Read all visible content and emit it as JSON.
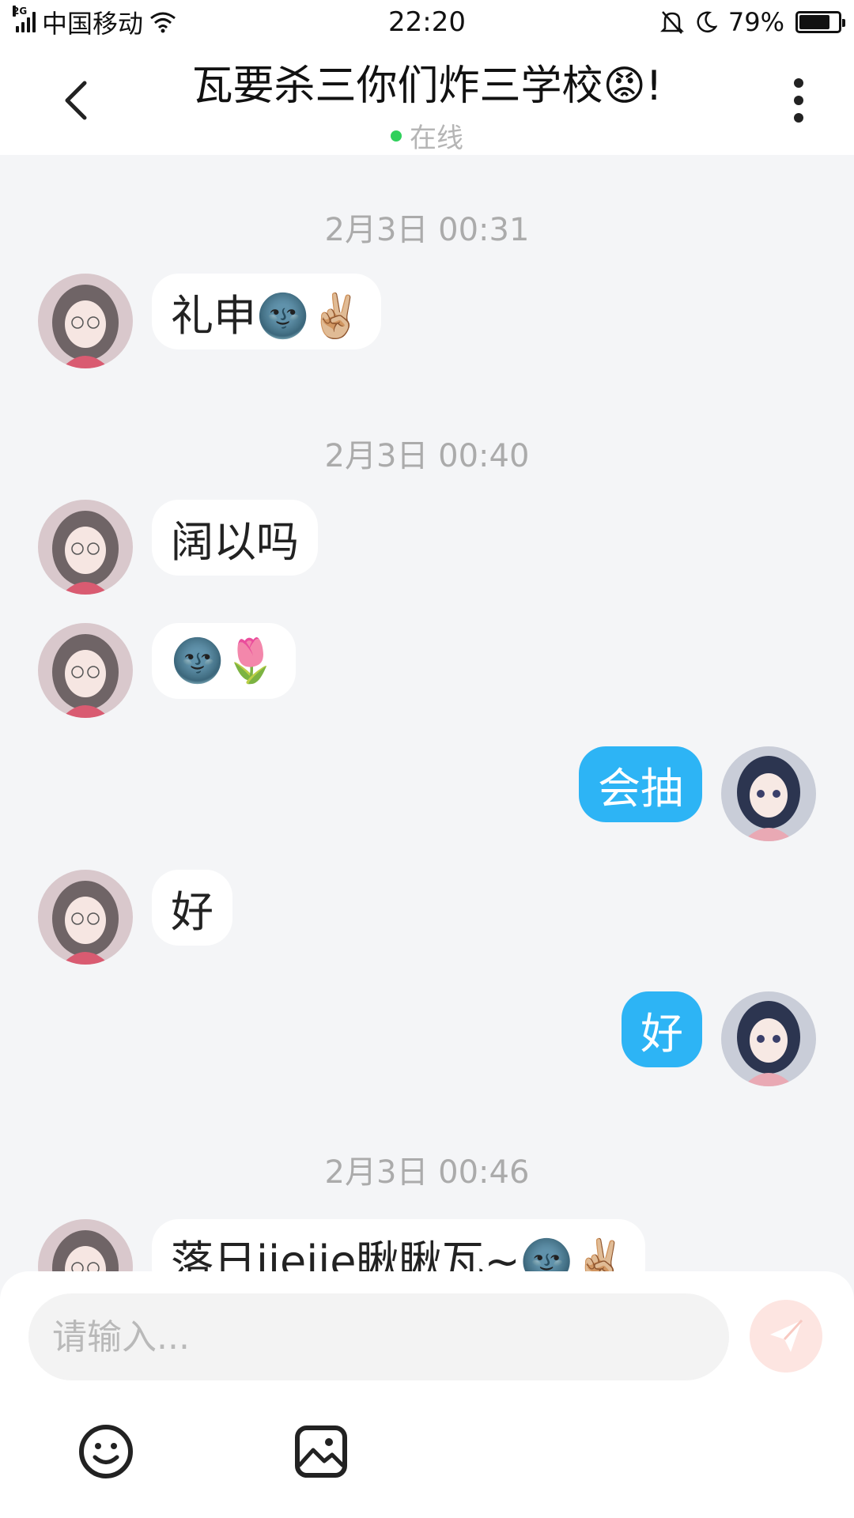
{
  "status_bar": {
    "network_type": "2G",
    "carrier": "中国移动",
    "time": "22:20",
    "battery_percent": "79%",
    "battery_level": 0.79
  },
  "header": {
    "title": "瓦要杀三你们炸三学校😡!",
    "status": "在线"
  },
  "messages": [
    {
      "type": "timestamp",
      "text": "2月3日 00:31"
    },
    {
      "type": "message",
      "side": "left",
      "text": "礼申🌚✌🏼"
    },
    {
      "type": "timestamp",
      "text": "2月3日 00:40"
    },
    {
      "type": "message",
      "side": "left",
      "text": "阔以吗"
    },
    {
      "type": "message",
      "side": "left",
      "text": "🌚🌷"
    },
    {
      "type": "message",
      "side": "right",
      "text": "会抽"
    },
    {
      "type": "message",
      "side": "left",
      "text": "好"
    },
    {
      "type": "message",
      "side": "right",
      "text": "好"
    },
    {
      "type": "timestamp",
      "text": "2月3日 00:46"
    },
    {
      "type": "message",
      "side": "left",
      "text": "落日jiejie瞅瞅瓦~🌚✌🏼"
    }
  ],
  "input": {
    "placeholder": "请输入..."
  },
  "icons": {
    "back": "chevron-left-icon",
    "more": "more-vertical-icon",
    "send": "send-icon",
    "emoji": "emoji-icon",
    "image": "image-icon"
  },
  "colors": {
    "self_bubble": "#2db4f5",
    "other_bubble": "#ffffff",
    "online_dot": "#2fd05b",
    "send_button": "#fde5e1",
    "background": "#f4f5f7"
  }
}
